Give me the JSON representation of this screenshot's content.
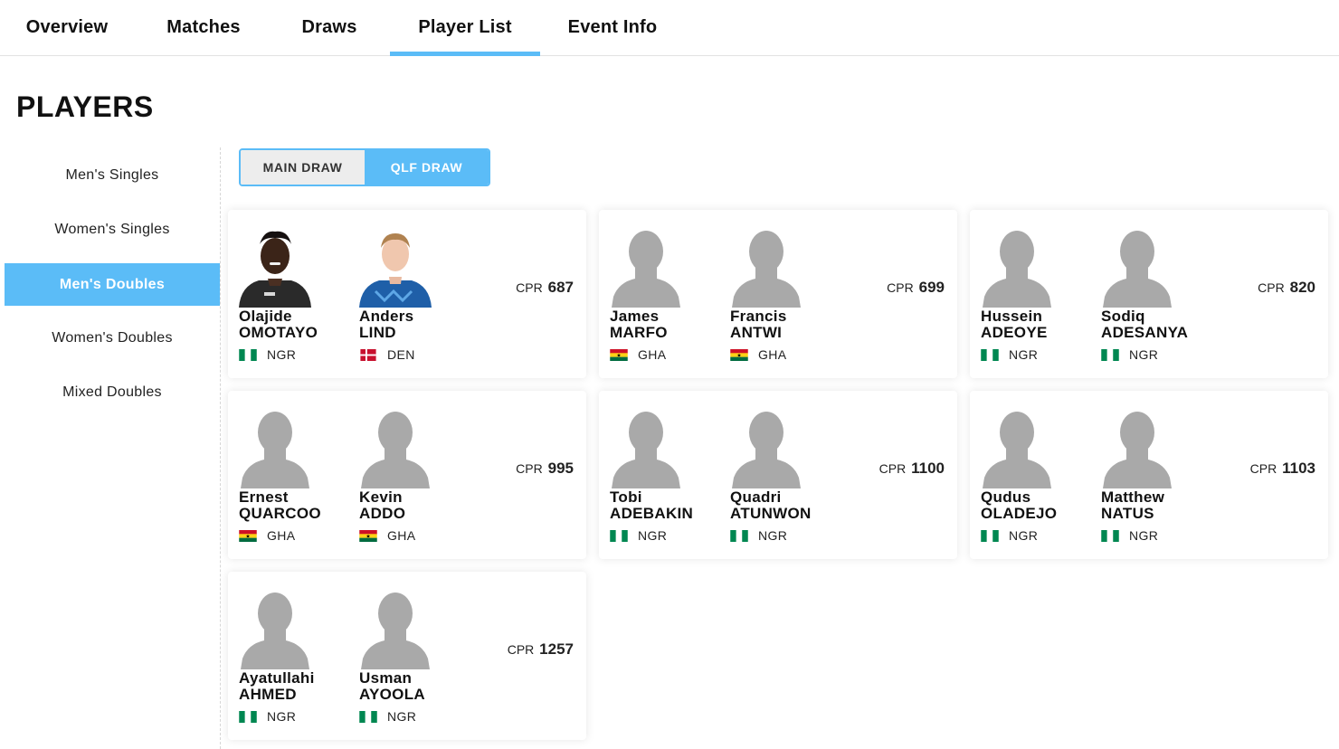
{
  "tabs": [
    {
      "label": "Overview"
    },
    {
      "label": "Matches"
    },
    {
      "label": "Draws"
    },
    {
      "label": "Player List",
      "active": true
    },
    {
      "label": "Event Info"
    }
  ],
  "page_title": "PLAYERS",
  "sidebar": {
    "items": [
      {
        "label": "Men's Singles"
      },
      {
        "label": "Women's Singles"
      },
      {
        "label": "Men's Doubles",
        "active": true
      },
      {
        "label": "Women's Doubles"
      },
      {
        "label": "Mixed Doubles"
      }
    ]
  },
  "draw_toggle": {
    "main": "MAIN DRAW",
    "qlf": "QLF DRAW",
    "selected": "qlf"
  },
  "cpr_prefix": "CPR",
  "colors": {
    "accent": "#5bbcf7"
  },
  "teams": [
    {
      "cpr": "687",
      "players": [
        {
          "first": "Olajide",
          "last": "OMOTAYO",
          "country": "NGR",
          "photo": "photo-dark-shirt"
        },
        {
          "first": "Anders",
          "last": "LIND",
          "country": "DEN",
          "photo": "photo-blue-shirt"
        }
      ]
    },
    {
      "cpr": "699",
      "players": [
        {
          "first": "James",
          "last": "MARFO",
          "country": "GHA",
          "photo": "placeholder"
        },
        {
          "first": "Francis",
          "last": "ANTWI",
          "country": "GHA",
          "photo": "placeholder"
        }
      ]
    },
    {
      "cpr": "820",
      "players": [
        {
          "first": "Hussein",
          "last": "ADEOYE",
          "country": "NGR",
          "photo": "placeholder"
        },
        {
          "first": "Sodiq",
          "last": "ADESANYA",
          "country": "NGR",
          "photo": "placeholder"
        }
      ]
    },
    {
      "cpr": "995",
      "players": [
        {
          "first": "Ernest",
          "last": "QUARCOO",
          "country": "GHA",
          "photo": "placeholder"
        },
        {
          "first": "Kevin",
          "last": "ADDO",
          "country": "GHA",
          "photo": "placeholder"
        }
      ]
    },
    {
      "cpr": "1100",
      "players": [
        {
          "first": "Tobi",
          "last": "ADEBAKIN",
          "country": "NGR",
          "photo": "placeholder"
        },
        {
          "first": "Quadri",
          "last": "ATUNWON",
          "country": "NGR",
          "photo": "placeholder"
        }
      ]
    },
    {
      "cpr": "1103",
      "players": [
        {
          "first": "Qudus",
          "last": "OLADEJO",
          "country": "NGR",
          "photo": "placeholder"
        },
        {
          "first": "Matthew",
          "last": "NATUS",
          "country": "NGR",
          "photo": "placeholder"
        }
      ]
    },
    {
      "cpr": "1257",
      "players": [
        {
          "first": "Ayatullahi",
          "last": "AHMED",
          "country": "NGR",
          "photo": "placeholder"
        },
        {
          "first": "Usman",
          "last": "AYOOLA",
          "country": "NGR",
          "photo": "placeholder"
        }
      ]
    }
  ]
}
